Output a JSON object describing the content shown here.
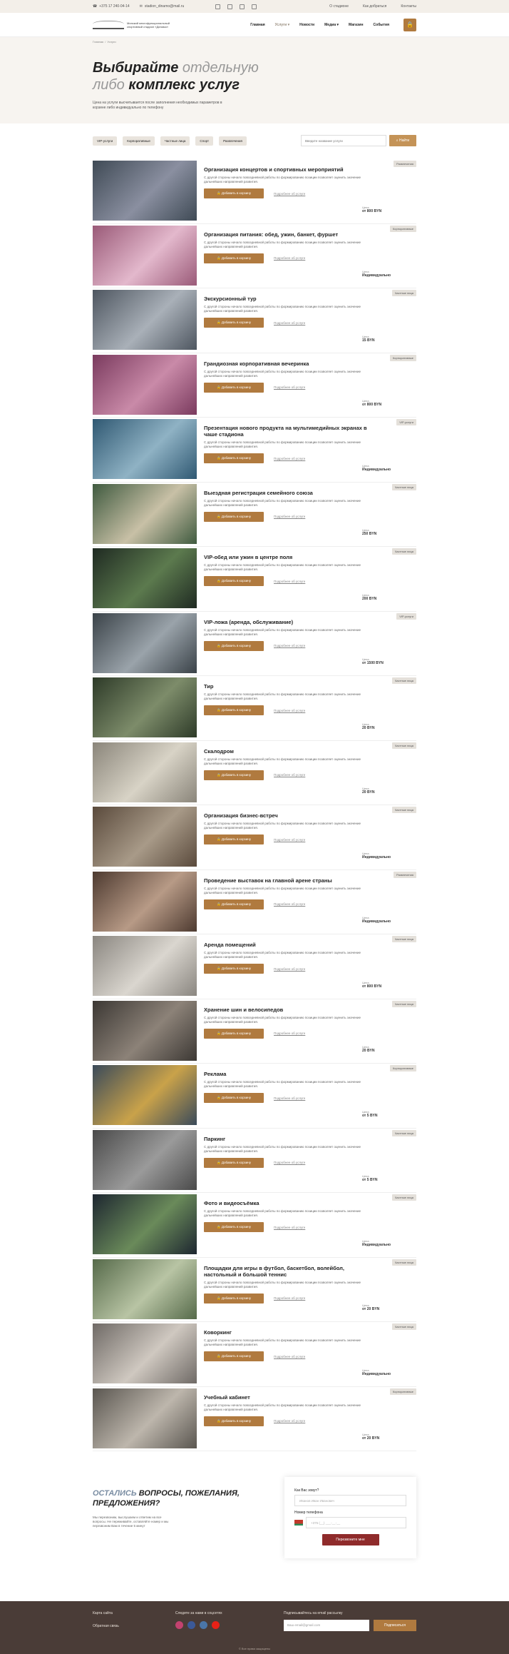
{
  "topbar": {
    "phone": "+375 17 240-04-14",
    "email": "stadion_dinamo@mail.ru",
    "links": [
      "О стадионе",
      "Как добраться",
      "Контакты"
    ]
  },
  "header": {
    "logo_text": "Минский многофункциональный спортивный стадион «Динамо»",
    "nav": [
      "Главная",
      "Услуги",
      "Новости",
      "Медиа",
      "Магазин",
      "События"
    ]
  },
  "breadcrumb": [
    "Главная",
    "Услуги"
  ],
  "hero": {
    "title_dark1": "Выбирайте",
    "title_light": "отдельную либо",
    "title_dark2": "комплекс услуг",
    "subtitle": "Цена на услуги высчитывается после заполнения необходимых параметров в корзине либо индивидуально по телефону"
  },
  "filters": {
    "chips": [
      "VIP-услуги",
      "Корпоративные",
      "Частные лица",
      "Спорт",
      "Развлечения"
    ],
    "search_placeholder": "Введите название услуги",
    "search_button": "Найти"
  },
  "card_labels": {
    "desc": "С другой стороны начало повседневной работы по формированию позиции позволяет оценить значение дальнейших направлений развития.",
    "add": "Добавить в корзину",
    "more": "Подробнее об услуге",
    "price_label": "Цена"
  },
  "services": [
    {
      "title": "Организация концертов и спортивных мероприятий",
      "tag": "Развлечения",
      "price": "от 800 BYN",
      "colors": [
        "#3f4a55",
        "#8a8fa0"
      ]
    },
    {
      "title": "Организация питания: обед, ужин, банкет, фуршет",
      "tag": "Корпоративные",
      "price": "Индивидуально",
      "colors": [
        "#9a5a78",
        "#e3b8cc"
      ]
    },
    {
      "title": "Экскурсионный тур",
      "tag": "Частные лица",
      "price": "15 BYN",
      "colors": [
        "#4e5660",
        "#a9b0b8"
      ]
    },
    {
      "title": "Грандиозная корпоративная вечеринка",
      "tag": "Корпоративные",
      "price": "от 800 BYN",
      "colors": [
        "#7a3a5e",
        "#c98aa8"
      ]
    },
    {
      "title": "Презентация нового продукта на мультимедийных экранах в чаше стадиона",
      "tag": "VIP-услуги",
      "price": "Индивидуально",
      "colors": [
        "#2f5872",
        "#8fb2c4"
      ]
    },
    {
      "title": "Выездная регистрация семейного союза",
      "tag": "Частные лица",
      "price": "250 BYN",
      "colors": [
        "#3f5a3f",
        "#c8c0a6"
      ]
    },
    {
      "title": "VIP-обед или ужин в центре поля",
      "tag": "Частные лица",
      "price": "200 BYN",
      "colors": [
        "#1f2a22",
        "#5c7a4e"
      ]
    },
    {
      "title": "VIP-ложа (аренда, обслуживание)",
      "tag": "VIP-услуги",
      "price": "от 1500 BYN",
      "colors": [
        "#3a4248",
        "#9aa3aa"
      ]
    },
    {
      "title": "Тир",
      "tag": "Частные лица",
      "price": "20 BYN",
      "colors": [
        "#2d3a28",
        "#7d8c6a"
      ]
    },
    {
      "title": "Скалодром",
      "tag": "Частные лица",
      "price": "20 BYN",
      "colors": [
        "#8a857a",
        "#d8d3c6"
      ]
    },
    {
      "title": "Организация бизнес-встреч",
      "tag": "Частные лица",
      "price": "Индивидуально",
      "colors": [
        "#5a4a3c",
        "#a89a88"
      ]
    },
    {
      "title": "Проведение выставок на главной арене страны",
      "tag": "Развлечения",
      "price": "Индивидуально",
      "colors": [
        "#4d3a30",
        "#b79a86"
      ]
    },
    {
      "title": "Аренда помещений",
      "tag": "Частные лица",
      "price": "от 800 BYN",
      "colors": [
        "#8a8680",
        "#dad6cf"
      ]
    },
    {
      "title": "Хранение шин и велосипедов",
      "tag": "Частные лица",
      "price": "20 BYN",
      "colors": [
        "#3c3834",
        "#8c8278"
      ]
    },
    {
      "title": "Реклама",
      "tag": "Корпоративные",
      "price": "от 5 BYN",
      "colors": [
        "#3a4a5a",
        "#c9a24a"
      ]
    },
    {
      "title": "Паркинг",
      "tag": "Частные лица",
      "price": "от 5 BYN",
      "colors": [
        "#4a4a4a",
        "#9a9a9a"
      ]
    },
    {
      "title": "Фото и видеосъёмка",
      "tag": "Частные лица",
      "price": "Индивидуально",
      "colors": [
        "#1d2630",
        "#6a8a5a"
      ]
    },
    {
      "title": "Площадки для игры в футбол, баскетбол, волейбол, настольный и большой теннис",
      "tag": "Частные лица",
      "price": "от 20 BYN",
      "colors": [
        "#566a4a",
        "#b8c4a4"
      ]
    },
    {
      "title": "Коворкинг",
      "tag": "Частные лица",
      "price": "Индивидуально",
      "colors": [
        "#6f6a66",
        "#cfc8c0"
      ]
    },
    {
      "title": "Учебный кабинет",
      "tag": "Корпоративные",
      "price": "от 20 BYN",
      "colors": [
        "#5a5650",
        "#bdb6ac"
      ]
    }
  ],
  "contact": {
    "title_blue": "ОСТАЛИСЬ",
    "title_dark": "ВОПРОСЫ, ПОЖЕЛАНИЯ, ПРЕДЛОЖЕНИЯ?",
    "text": "Мы перезвоним, выслушаем и ответим на все вопросы. Не переживайте, оставляйте номер и мы перезвоним Вам в течение 5 минут",
    "name_label": "Как Вас зовут?",
    "name_placeholder": "Иванов Иван Иванович",
    "phone_label": "Номер телефона",
    "phone_placeholder": "+375 (__) ___-__-__",
    "submit": "Перезвоните мне"
  },
  "footer": {
    "links": [
      "Карта сайта",
      "Обратная связь"
    ],
    "socials_title": "Следите за нами в соцсетях",
    "social_colors": [
      "#c2426f",
      "#3b5998",
      "#4a76a8",
      "#e62117"
    ],
    "subscribe_title": "Подписывайтесь на email рассылку",
    "subscribe_placeholder": "Ваш email@gmail.com",
    "subscribe_button": "Подписаться",
    "copyright": "© Все права защищены"
  }
}
